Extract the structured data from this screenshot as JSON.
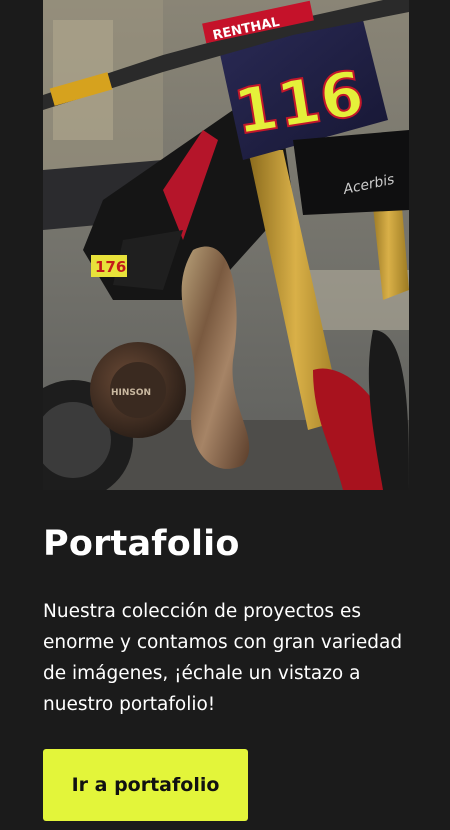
{
  "card": {
    "image_alt": "Motocicleta de motocross con número 116",
    "title": "Portafolio",
    "description": "Nuestra colección de proyectos es enorme y contamos con gran variedad de imágenes, ¡échale un vistazo a nuestro portafolio!",
    "button_label": "Ir a portafolio"
  },
  "colors": {
    "background": "#1b1b1b",
    "button": "#e3f53a",
    "button_text": "#111111",
    "text": "#ffffff"
  }
}
